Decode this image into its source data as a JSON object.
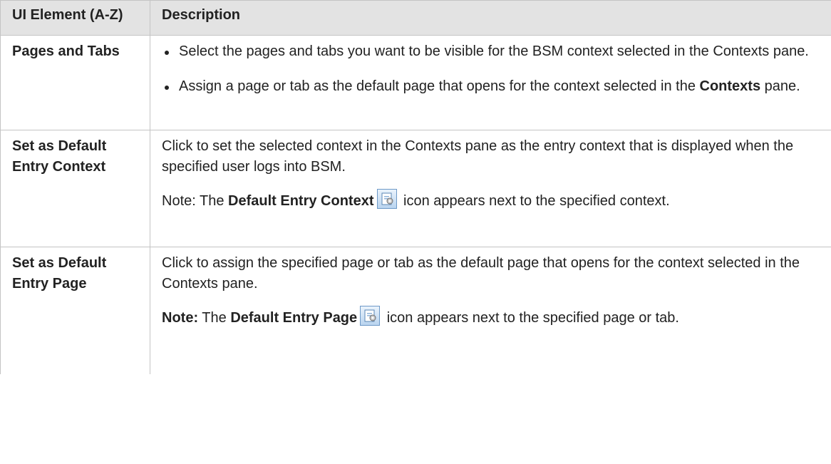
{
  "header": {
    "col_element": "UI Element (A-Z)",
    "col_description": "Description"
  },
  "rows": [
    {
      "element": "Pages and Tabs",
      "bullets": [
        {
          "text": "Select the pages and tabs you want to be visible for the BSM context selected in the Contexts pane."
        },
        {
          "text_before": "Assign a page or tab as the default page that opens for the context selected in the ",
          "bold": "Contexts",
          "text_after": " pane."
        }
      ]
    },
    {
      "element": "Set as Default Entry Context",
      "para1": "Click to set the selected context in the Contexts pane as the entry context that is displayed when the specified user logs into BSM.",
      "note_prefix": "Note: The ",
      "note_bold": "Default Entry Context",
      "note_after": " icon appears next to the specified context.",
      "icon": "default-entry-icon"
    },
    {
      "element": "Set as Default Entry Page",
      "para1": "Click to assign the specified page or tab as the default page that opens for the context selected in the Contexts pane.",
      "note_label": "Note:",
      "note_prefix": " The ",
      "note_bold": "Default Entry Page",
      "note_after": " icon appears next to the specified page or tab.",
      "icon": "default-entry-icon"
    }
  ]
}
